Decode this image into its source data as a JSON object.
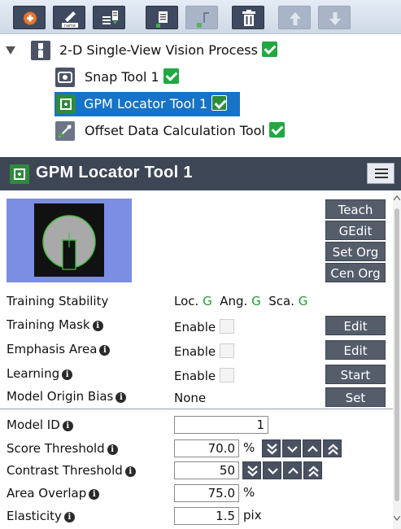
{
  "toolbar": {
    "buttons": [
      {
        "name": "add-button",
        "icon": "plus-icon"
      },
      {
        "name": "rename-button",
        "icon": "rename-icon",
        "icon_text": "name"
      },
      {
        "name": "add-child-button",
        "icon": "list-add-icon"
      },
      {
        "name": "paste-button",
        "icon": "clipboard-icon"
      },
      {
        "name": "cut-button",
        "icon": "cut-icon"
      },
      {
        "name": "delete-button",
        "icon": "trash-icon"
      },
      {
        "name": "move-up-button",
        "icon": "arrow-up-icon"
      },
      {
        "name": "move-down-button",
        "icon": "arrow-down-icon"
      }
    ]
  },
  "tree": {
    "root": {
      "label": "2-D Single-View Vision Process",
      "checked": true
    },
    "children": [
      {
        "label": "Snap Tool 1",
        "checked": true
      },
      {
        "label": "GPM Locator Tool 1",
        "checked": true,
        "selected": true
      },
      {
        "label": "Offset Data Calculation Tool",
        "checked": true
      }
    ]
  },
  "panel": {
    "title": "GPM Locator Tool 1",
    "side_buttons": [
      "Teach",
      "GEdit",
      "Set Org",
      "Cen Org"
    ],
    "training_stability": {
      "label": "Training Stability",
      "loc_label": "Loc.",
      "loc_value": "G",
      "ang_label": "Ang.",
      "ang_value": "G",
      "sca_label": "Sca.",
      "sca_value": "G"
    },
    "rows": [
      {
        "label": "Training Mask",
        "value": "Enable",
        "button": "Edit"
      },
      {
        "label": "Emphasis Area",
        "value": "Enable",
        "button": "Edit"
      },
      {
        "label": "Learning",
        "value": "Enable",
        "button": "Start"
      },
      {
        "label": "Model Origin Bias",
        "value": "None",
        "button": "Set"
      }
    ],
    "params": {
      "model_id": {
        "label": "Model ID",
        "value": "1"
      },
      "score_threshold": {
        "label": "Score Threshold",
        "value": "70.0",
        "unit": "%"
      },
      "contrast_threshold": {
        "label": "Contrast Threshold",
        "value": "50"
      },
      "area_overlap": {
        "label": "Area Overlap",
        "value": "75.0",
        "unit": "%"
      },
      "elasticity": {
        "label": "Elasticity",
        "value": "1.5",
        "unit": "pix"
      }
    },
    "info_glyph": "i"
  },
  "colors": {
    "selected_row": "#1673c7",
    "check_green": "#21a842",
    "header_bg": "#3d4655",
    "button_bg": "#555d6b",
    "stability_green": "#1f9e2d"
  }
}
